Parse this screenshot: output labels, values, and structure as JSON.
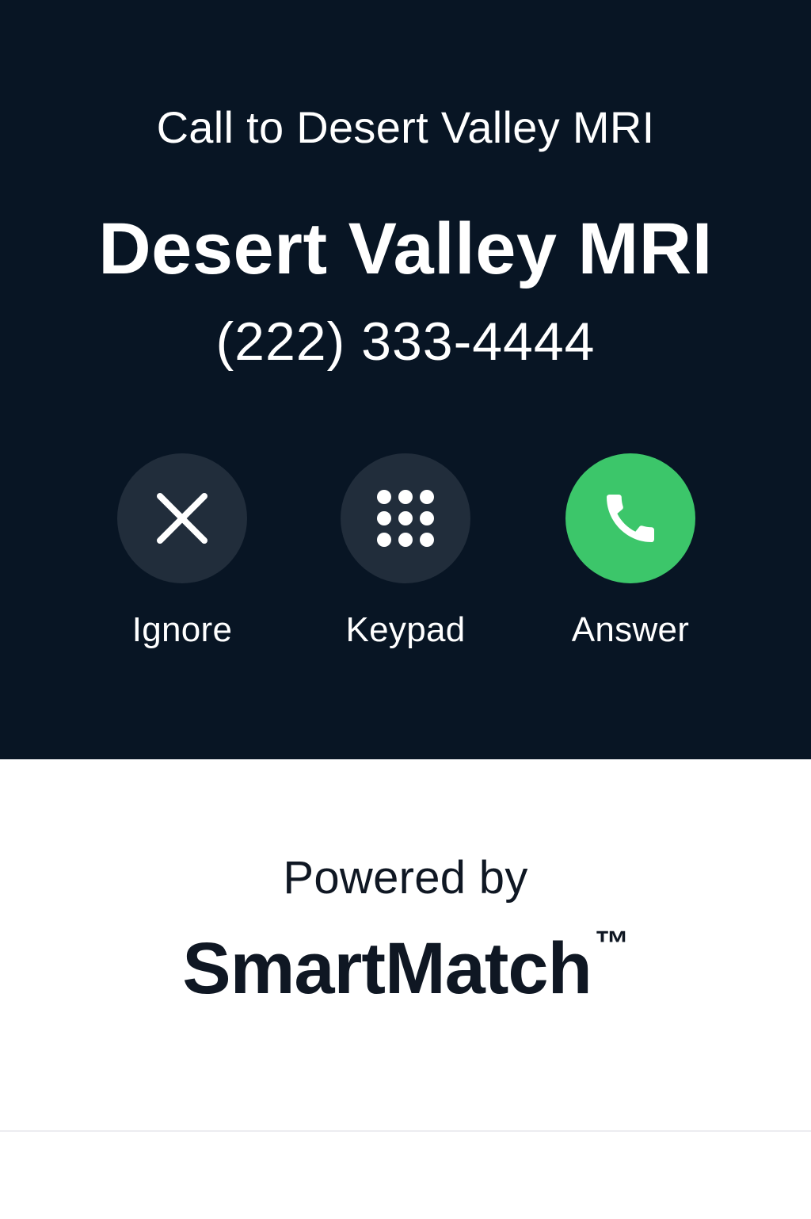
{
  "call": {
    "subtitle": "Call to Desert Valley MRI",
    "caller_name": "Desert Valley MRI",
    "caller_number": "(222) 333-4444"
  },
  "actions": [
    {
      "label": "Ignore",
      "icon": "close-icon",
      "color": "#212d3b"
    },
    {
      "label": "Keypad",
      "icon": "keypad-icon",
      "color": "#212d3b"
    },
    {
      "label": "Answer",
      "icon": "phone-icon",
      "color": "#3cc66a"
    }
  ],
  "branding": {
    "powered_by": "Powered by",
    "name": "SmartMatch",
    "trademark": "™"
  },
  "colors": {
    "background": "#081524",
    "accent_green": "#3cc66a",
    "button_dark": "#212d3b"
  }
}
